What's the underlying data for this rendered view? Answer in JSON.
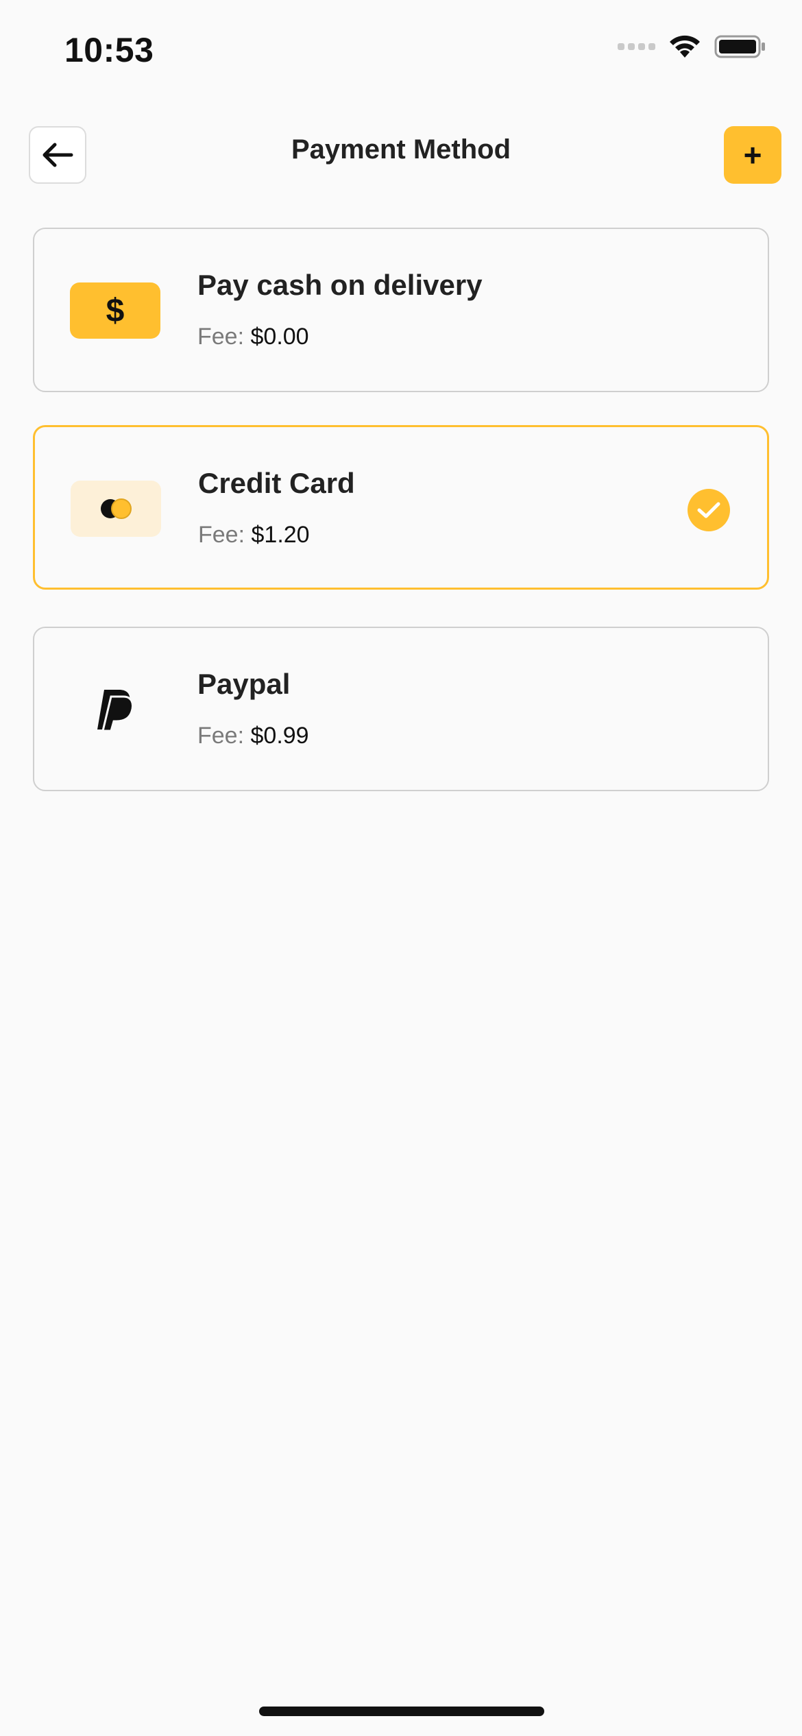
{
  "status_bar": {
    "time": "10:53"
  },
  "header": {
    "title": "Payment Method",
    "add_label": "+"
  },
  "payment_methods": [
    {
      "name": "Pay cash on delivery",
      "fee_label": "Fee:",
      "fee_value": "$0.00",
      "icon": "dollar-icon",
      "selected": false
    },
    {
      "name": "Credit Card",
      "fee_label": "Fee:",
      "fee_value": "$1.20",
      "icon": "credit-card-icon",
      "selected": true
    },
    {
      "name": "Paypal",
      "fee_label": "Fee:",
      "fee_value": "$0.99",
      "icon": "paypal-icon",
      "selected": false
    }
  ],
  "colors": {
    "accent": "#ffbf2f",
    "background": "#fafafa",
    "card_border": "#cfcfcf"
  }
}
